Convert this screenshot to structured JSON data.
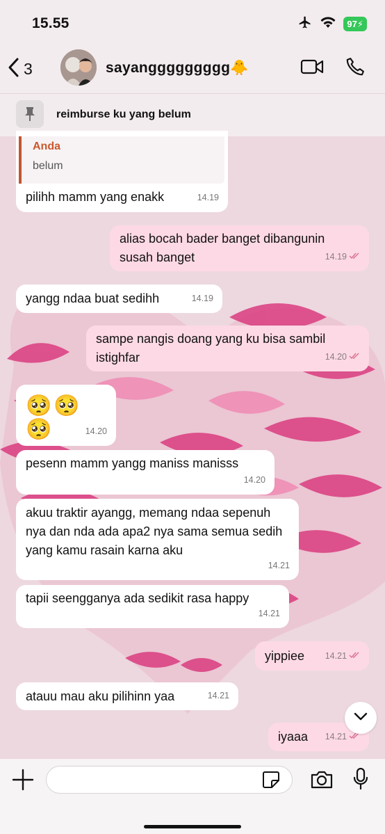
{
  "status": {
    "time": "15.55",
    "battery": "97"
  },
  "header": {
    "back_count": "3",
    "contact_name": "sayanggggggggg",
    "contact_emoji": "🐥"
  },
  "pinned": {
    "text": "reimburse ku yang belum"
  },
  "quote": {
    "author": "Anda",
    "text": "belum"
  },
  "messages": [
    {
      "text": "pilihh mamm yang enakk",
      "time": "14.19",
      "dir": "in"
    },
    {
      "text": "alias bocah bader banget dibangunin susah banget",
      "time": "14.19",
      "dir": "out"
    },
    {
      "text": "yangg ndaa buat sedihh",
      "time": "14.19",
      "dir": "in"
    },
    {
      "text": "sampe nangis doang yang ku bisa sambil istighfar",
      "time": "14.20",
      "dir": "out"
    },
    {
      "text": "🥺🥺🥺",
      "time": "14.20",
      "dir": "in"
    },
    {
      "text": "pesenn mamm yangg maniss manisss",
      "time": "14.20",
      "dir": "in"
    },
    {
      "text": "akuu traktir ayangg, memang ndaa sepenuh nya dan nda ada apa2 nya sama semua sedih yang kamu rasain karna aku",
      "time": "14.21",
      "dir": "in"
    },
    {
      "text": "tapii seengganya ada sedikit rasa happy",
      "time": "14.21",
      "dir": "in"
    },
    {
      "text": "yippiee",
      "time": "14.21",
      "dir": "out"
    },
    {
      "text": "atauu mau aku pilihinn yaa",
      "time": "14.21",
      "dir": "in"
    },
    {
      "text": "iyaaa",
      "time": "14.21",
      "dir": "out"
    }
  ],
  "colors": {
    "incoming_bubble": "#ffffff",
    "outgoing_bubble": "#fdd9e5",
    "read_ticks": "#d86f8e",
    "quote_accent": "#c4552f"
  },
  "icons": [
    "airplane-icon",
    "wifi-icon",
    "back-chevron-icon",
    "video-call-icon",
    "phone-icon",
    "pin-icon",
    "double-check-icon",
    "chevron-down-icon",
    "plus-icon",
    "sticker-icon",
    "camera-icon",
    "microphone-icon"
  ]
}
